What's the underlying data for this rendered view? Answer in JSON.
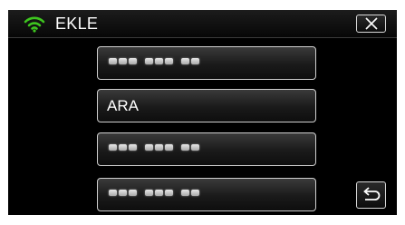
{
  "header": {
    "title": "EKLE",
    "wifi_icon": "wifi-icon",
    "wifi_color": "#3ec61f",
    "close_icon": "close-icon"
  },
  "list": {
    "items": [
      {
        "label": "",
        "masked": true
      },
      {
        "label": "ARA",
        "masked": false
      },
      {
        "label": "",
        "masked": true
      },
      {
        "label": "",
        "masked": true
      }
    ]
  },
  "footer": {
    "back_icon": "return-arrow-icon"
  }
}
